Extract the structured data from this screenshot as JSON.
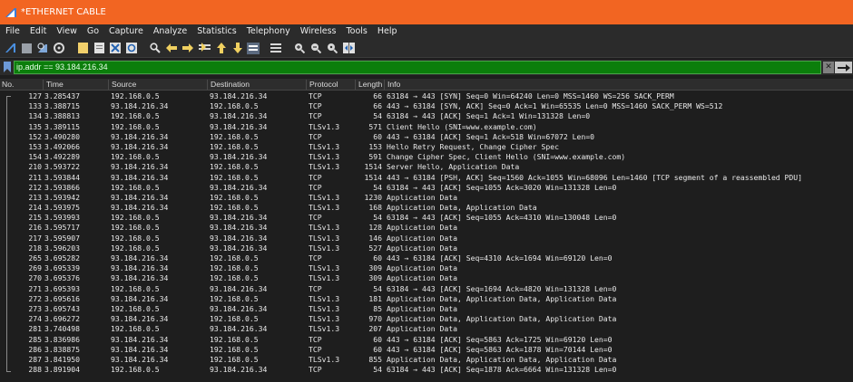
{
  "window": {
    "title": "*ETHERNET CABLE"
  },
  "menu": [
    "File",
    "Edit",
    "View",
    "Go",
    "Capture",
    "Analyze",
    "Statistics",
    "Telephony",
    "Wireless",
    "Tools",
    "Help"
  ],
  "toolbar": {
    "icons": [
      "shark-fin-start-icon",
      "stop-icon",
      "restart-icon",
      "capture-options-icon",
      "open-file-icon",
      "save-file-icon",
      "close-file-icon",
      "reload-icon",
      "find-icon",
      "go-back-icon",
      "go-forward-icon",
      "go-to-packet-icon",
      "go-first-icon",
      "go-last-icon",
      "autoscroll-icon",
      "colorize-icon",
      "zoom-in-icon",
      "zoom-out-icon",
      "zoom-normal-icon",
      "resize-columns-icon"
    ]
  },
  "filter": {
    "value": "ip.addr == 93.184.216.34"
  },
  "columns": {
    "no": "No.",
    "time": "Time",
    "source": "Source",
    "destination": "Destination",
    "protocol": "Protocol",
    "length": "Length",
    "info": "Info"
  },
  "packets": [
    {
      "no": "127",
      "time": "3.285437",
      "src": "192.168.0.5",
      "dst": "93.184.216.34",
      "proto": "TCP",
      "len": "66",
      "info": "63184 → 443 [SYN] Seq=0 Win=64240 Len=0 MSS=1460 WS=256 SACK_PERM"
    },
    {
      "no": "133",
      "time": "3.388715",
      "src": "93.184.216.34",
      "dst": "192.168.0.5",
      "proto": "TCP",
      "len": "66",
      "info": "443 → 63184 [SYN, ACK] Seq=0 Ack=1 Win=65535 Len=0 MSS=1460 SACK_PERM WS=512"
    },
    {
      "no": "134",
      "time": "3.388813",
      "src": "192.168.0.5",
      "dst": "93.184.216.34",
      "proto": "TCP",
      "len": "54",
      "info": "63184 → 443 [ACK] Seq=1 Ack=1 Win=131328 Len=0"
    },
    {
      "no": "135",
      "time": "3.389115",
      "src": "192.168.0.5",
      "dst": "93.184.216.34",
      "proto": "TLSv1.3",
      "len": "571",
      "info": "Client Hello (SNI=www.example.com)"
    },
    {
      "no": "152",
      "time": "3.490280",
      "src": "93.184.216.34",
      "dst": "192.168.0.5",
      "proto": "TCP",
      "len": "60",
      "info": "443 → 63184 [ACK] Seq=1 Ack=518 Win=67072 Len=0"
    },
    {
      "no": "153",
      "time": "3.492066",
      "src": "93.184.216.34",
      "dst": "192.168.0.5",
      "proto": "TLSv1.3",
      "len": "153",
      "info": "Hello Retry Request, Change Cipher Spec"
    },
    {
      "no": "154",
      "time": "3.492289",
      "src": "192.168.0.5",
      "dst": "93.184.216.34",
      "proto": "TLSv1.3",
      "len": "591",
      "info": "Change Cipher Spec, Client Hello (SNI=www.example.com)"
    },
    {
      "no": "210",
      "time": "3.593722",
      "src": "93.184.216.34",
      "dst": "192.168.0.5",
      "proto": "TLSv1.3",
      "len": "1514",
      "info": "Server Hello, Application Data"
    },
    {
      "no": "211",
      "time": "3.593844",
      "src": "93.184.216.34",
      "dst": "192.168.0.5",
      "proto": "TCP",
      "len": "1514",
      "info": "443 → 63184 [PSH, ACK] Seq=1560 Ack=1055 Win=68096 Len=1460 [TCP segment of a reassembled PDU]"
    },
    {
      "no": "212",
      "time": "3.593866",
      "src": "192.168.0.5",
      "dst": "93.184.216.34",
      "proto": "TCP",
      "len": "54",
      "info": "63184 → 443 [ACK] Seq=1055 Ack=3020 Win=131328 Len=0"
    },
    {
      "no": "213",
      "time": "3.593942",
      "src": "93.184.216.34",
      "dst": "192.168.0.5",
      "proto": "TLSv1.3",
      "len": "1230",
      "info": "Application Data"
    },
    {
      "no": "214",
      "time": "3.593975",
      "src": "93.184.216.34",
      "dst": "192.168.0.5",
      "proto": "TLSv1.3",
      "len": "168",
      "info": "Application Data, Application Data"
    },
    {
      "no": "215",
      "time": "3.593993",
      "src": "192.168.0.5",
      "dst": "93.184.216.34",
      "proto": "TCP",
      "len": "54",
      "info": "63184 → 443 [ACK] Seq=1055 Ack=4310 Win=130048 Len=0"
    },
    {
      "no": "216",
      "time": "3.595717",
      "src": "192.168.0.5",
      "dst": "93.184.216.34",
      "proto": "TLSv1.3",
      "len": "128",
      "info": "Application Data"
    },
    {
      "no": "217",
      "time": "3.595907",
      "src": "192.168.0.5",
      "dst": "93.184.216.34",
      "proto": "TLSv1.3",
      "len": "146",
      "info": "Application Data"
    },
    {
      "no": "218",
      "time": "3.596203",
      "src": "192.168.0.5",
      "dst": "93.184.216.34",
      "proto": "TLSv1.3",
      "len": "527",
      "info": "Application Data"
    },
    {
      "no": "265",
      "time": "3.695282",
      "src": "93.184.216.34",
      "dst": "192.168.0.5",
      "proto": "TCP",
      "len": "60",
      "info": "443 → 63184 [ACK] Seq=4310 Ack=1694 Win=69120 Len=0"
    },
    {
      "no": "269",
      "time": "3.695339",
      "src": "93.184.216.34",
      "dst": "192.168.0.5",
      "proto": "TLSv1.3",
      "len": "309",
      "info": "Application Data"
    },
    {
      "no": "270",
      "time": "3.695376",
      "src": "93.184.216.34",
      "dst": "192.168.0.5",
      "proto": "TLSv1.3",
      "len": "309",
      "info": "Application Data"
    },
    {
      "no": "271",
      "time": "3.695393",
      "src": "192.168.0.5",
      "dst": "93.184.216.34",
      "proto": "TCP",
      "len": "54",
      "info": "63184 → 443 [ACK] Seq=1694 Ack=4820 Win=131328 Len=0"
    },
    {
      "no": "272",
      "time": "3.695616",
      "src": "93.184.216.34",
      "dst": "192.168.0.5",
      "proto": "TLSv1.3",
      "len": "181",
      "info": "Application Data, Application Data, Application Data"
    },
    {
      "no": "273",
      "time": "3.695743",
      "src": "192.168.0.5",
      "dst": "93.184.216.34",
      "proto": "TLSv1.3",
      "len": "85",
      "info": "Application Data"
    },
    {
      "no": "274",
      "time": "3.696272",
      "src": "93.184.216.34",
      "dst": "192.168.0.5",
      "proto": "TLSv1.3",
      "len": "970",
      "info": "Application Data, Application Data, Application Data"
    },
    {
      "no": "281",
      "time": "3.740498",
      "src": "192.168.0.5",
      "dst": "93.184.216.34",
      "proto": "TLSv1.3",
      "len": "207",
      "info": "Application Data"
    },
    {
      "no": "285",
      "time": "3.836986",
      "src": "93.184.216.34",
      "dst": "192.168.0.5",
      "proto": "TCP",
      "len": "60",
      "info": "443 → 63184 [ACK] Seq=5863 Ack=1725 Win=69120 Len=0"
    },
    {
      "no": "286",
      "time": "3.838875",
      "src": "93.184.216.34",
      "dst": "192.168.0.5",
      "proto": "TCP",
      "len": "60",
      "info": "443 → 63184 [ACK] Seq=5863 Ack=1878 Win=70144 Len=0"
    },
    {
      "no": "287",
      "time": "3.841950",
      "src": "93.184.216.34",
      "dst": "192.168.0.5",
      "proto": "TLSv1.3",
      "len": "855",
      "info": "Application Data, Application Data, Application Data"
    },
    {
      "no": "288",
      "time": "3.891904",
      "src": "192.168.0.5",
      "dst": "93.184.216.34",
      "proto": "TCP",
      "len": "54",
      "info": "63184 → 443 [ACK] Seq=1878 Ack=6664 Win=131328 Len=0"
    }
  ],
  "colors": {
    "titlebar": "#f26522",
    "filter_valid": "#0b7e0b",
    "background": "#1e1e1e"
  }
}
